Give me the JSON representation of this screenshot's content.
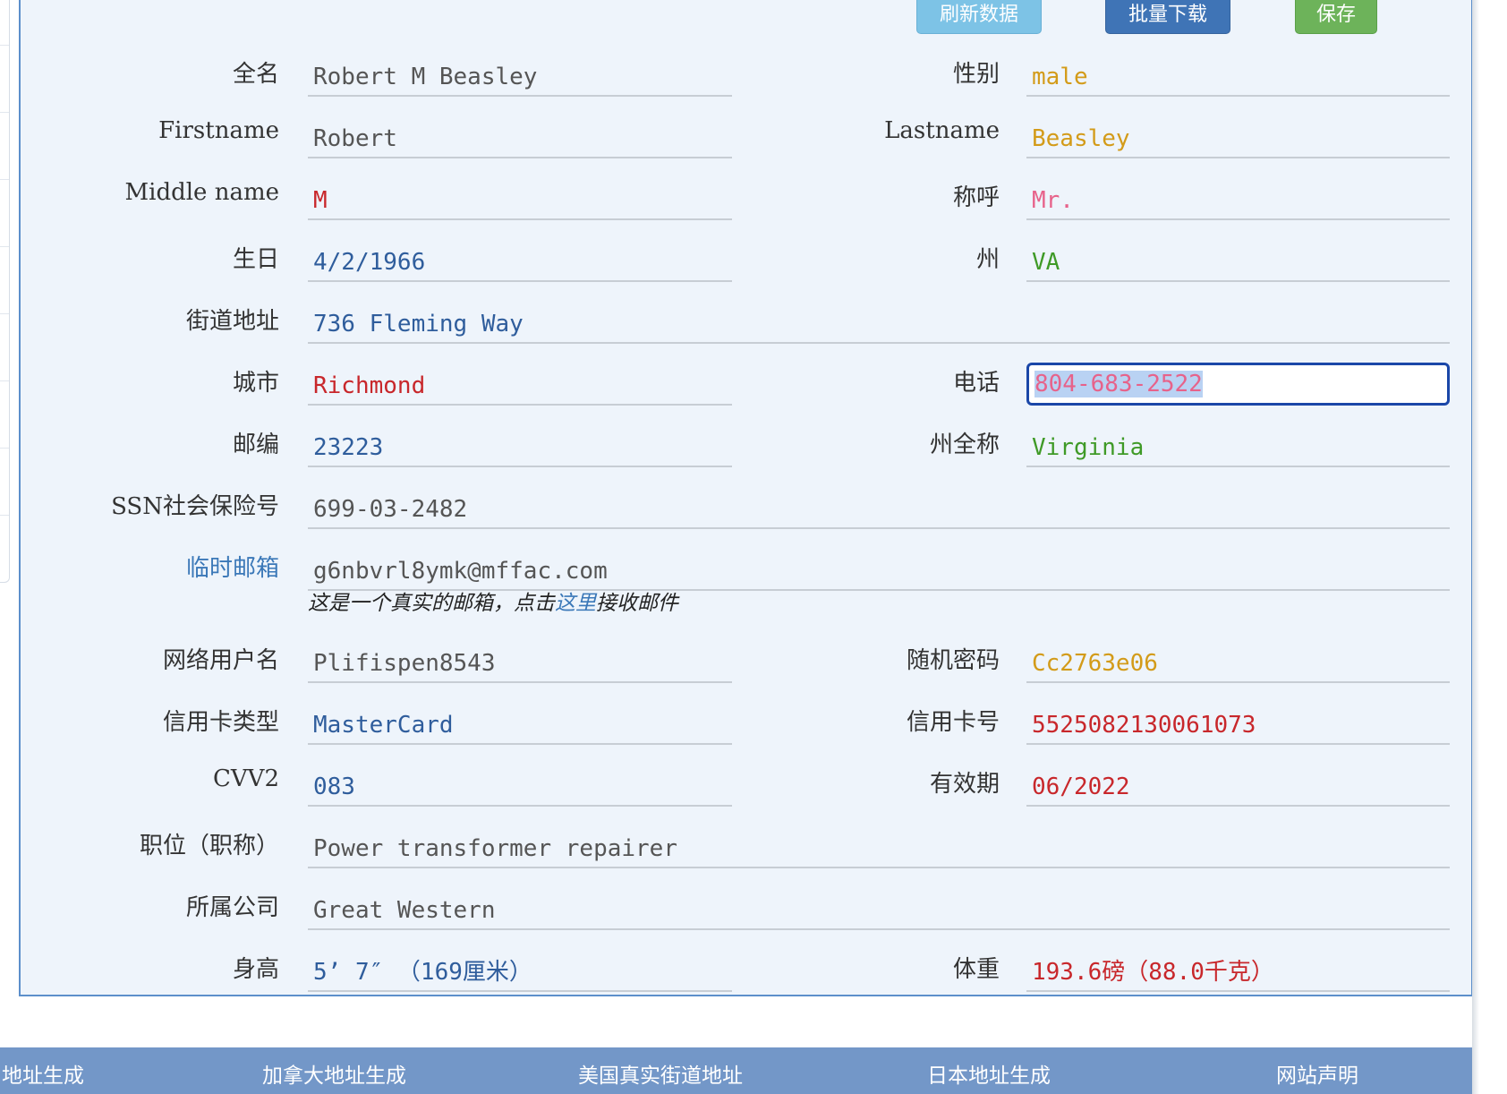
{
  "buttons": {
    "refresh": "刷新数据",
    "batch_download": "批量下载",
    "save": "保存"
  },
  "form": {
    "full_name": {
      "label": "全名",
      "value": "Robert M Beasley"
    },
    "gender": {
      "label": "性别",
      "value": "male"
    },
    "firstname": {
      "label": "Firstname",
      "value": "Robert"
    },
    "lastname": {
      "label": "Lastname",
      "value": "Beasley"
    },
    "middle_name": {
      "label": "Middle name",
      "value": "M"
    },
    "title": {
      "label": "称呼",
      "value": "Mr."
    },
    "birthday": {
      "label": "生日",
      "value": "4/2/1966"
    },
    "state": {
      "label": "州",
      "value": "VA"
    },
    "street": {
      "label": "街道地址",
      "value": "736 Fleming Way"
    },
    "city": {
      "label": "城市",
      "value": "Richmond"
    },
    "phone": {
      "label": "电话",
      "value": "804-683-2522"
    },
    "zip": {
      "label": "邮编",
      "value": "23223"
    },
    "state_full": {
      "label": "州全称",
      "value": "Virginia"
    },
    "ssn": {
      "label": "SSN社会保险号",
      "value": "699-03-2482"
    },
    "temp_email": {
      "label": "临时邮箱",
      "value": "g6nbvrl8ymk@mffac.com"
    },
    "email_note": {
      "prefix": "这是一个真实的邮箱，点击",
      "link": "这里",
      "suffix": "接收邮件"
    },
    "username": {
      "label": "网络用户名",
      "value": "Plifispen8543"
    },
    "password": {
      "label": "随机密码",
      "value": "Cc2763e06"
    },
    "card_type": {
      "label": "信用卡类型",
      "value": "MasterCard"
    },
    "card_number": {
      "label": "信用卡号",
      "value": "5525082130061073"
    },
    "cvv2": {
      "label": "CVV2",
      "value": "083"
    },
    "expiry": {
      "label": "有效期",
      "value": "06/2022"
    },
    "occupation": {
      "label": "职位（职称）",
      "value": "Power transformer repairer"
    },
    "company": {
      "label": "所属公司",
      "value": "Great Western"
    },
    "height": {
      "label": "身高",
      "value": "5’ 7″ （169厘米）"
    },
    "weight": {
      "label": "体重",
      "value": "193.6磅（88.0千克）"
    }
  },
  "footer": {
    "links": [
      "地址生成",
      "加拿大地址生成",
      "美国真实街道地址",
      "日本地址生成",
      "网站声明"
    ]
  },
  "colors": {
    "panel_border": "#5c8fcb",
    "panel_bg": "#eef4fb",
    "footer_bg": "#7397c8",
    "focus_border": "#1b47a8"
  }
}
